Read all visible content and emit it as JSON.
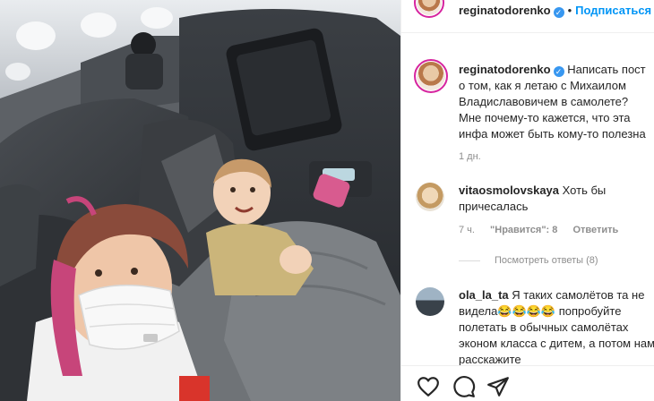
{
  "post": {
    "username": "reginatodorenko",
    "follow_label": "Подписаться",
    "separator": "•",
    "caption": "Написать пост о том, как я летаю с Михаилом Владиславовичем в самолете? Мне почему-то кажется, что эта инфа может быть кому-то полезна",
    "caption_time": "1 дн."
  },
  "comments": [
    {
      "username": "vitaosmolovskaya",
      "text": "Хоть бы причесалась",
      "time": "7 ч.",
      "likes": "\"Нравится\": 8",
      "reply_label": "Ответить"
    },
    {
      "username": "ola_la_ta",
      "text": "Я таких самолётов та не видела😂😂😂😂 попробуйте полетать в обычных самолётах эконом класса с дитем, а потом нам расскажите"
    }
  ],
  "view_replies_label": "Посмотреть ответы (8)",
  "icons": {
    "verified": "verified-badge-icon",
    "like": "heart-icon",
    "comment": "comment-bubble-icon",
    "share": "paper-plane-icon"
  },
  "colors": {
    "accent_blue": "#0095f6",
    "verified_blue": "#3897f0",
    "muted": "#8e8e8e"
  }
}
